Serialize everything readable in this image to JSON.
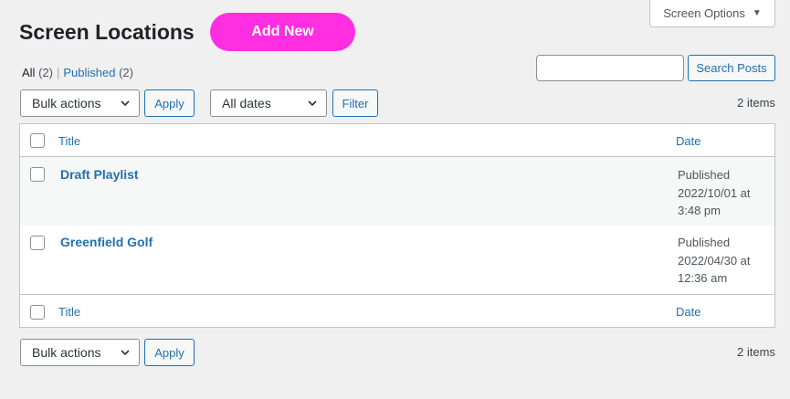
{
  "screen_options": {
    "label": "Screen Options"
  },
  "header": {
    "title": "Screen Locations",
    "add_new_label": "Add New"
  },
  "views": {
    "all_label": "All",
    "all_count": "(2)",
    "separator": "|",
    "published_label": "Published",
    "published_count": "(2)"
  },
  "search": {
    "value": "",
    "placeholder": "",
    "button_label": "Search Posts"
  },
  "toolbar_top": {
    "bulk_actions": "Bulk actions",
    "apply_label": "Apply",
    "dates": "All dates",
    "filter_label": "Filter",
    "items_count": "2 items"
  },
  "toolbar_bottom": {
    "bulk_actions": "Bulk actions",
    "apply_label": "Apply",
    "items_count": "2 items"
  },
  "table": {
    "columns": {
      "title": "Title",
      "date": "Date"
    },
    "rows": [
      {
        "title": "Draft Playlist",
        "status": "Published",
        "date": "2022/10/01 at",
        "time": "3:48 pm"
      },
      {
        "title": "Greenfield Golf",
        "status": "Published",
        "date": "2022/04/30 at",
        "time": "12:36 am"
      }
    ]
  },
  "colors": {
    "accent": "#2271b1",
    "add_new_bg": "#ff2ee0",
    "background": "#f0f0f1"
  },
  "icons": [
    "caret-down-icon",
    "chevron-down-icon",
    "checkbox-icon"
  ]
}
